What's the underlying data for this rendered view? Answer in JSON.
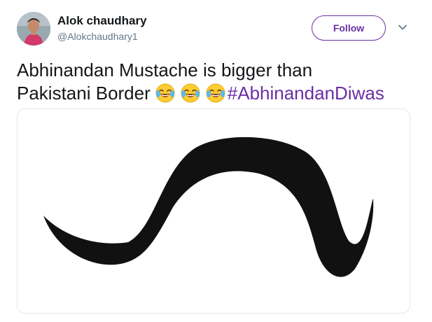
{
  "user": {
    "name": "Alok chaudhary",
    "handle": "@Alokchaudhary1"
  },
  "follow_button": {
    "label": "Follow"
  },
  "tweet": {
    "text_line1": "Abhinandan Mustache is bigger than",
    "text_line2": "Pakistani Border",
    "emojis": [
      "face-with-tears-of-joy-emoji",
      "face-with-tears-of-joy-emoji",
      "face-with-tears-of-joy-emoji"
    ],
    "hashtag": "#AbhinandanDiwas"
  },
  "media": {
    "content": "mustache-image"
  },
  "colors": {
    "accent": "#6b2fa3",
    "text": "#14171a",
    "secondary_text": "#657786",
    "border": "#e1e8ed"
  }
}
